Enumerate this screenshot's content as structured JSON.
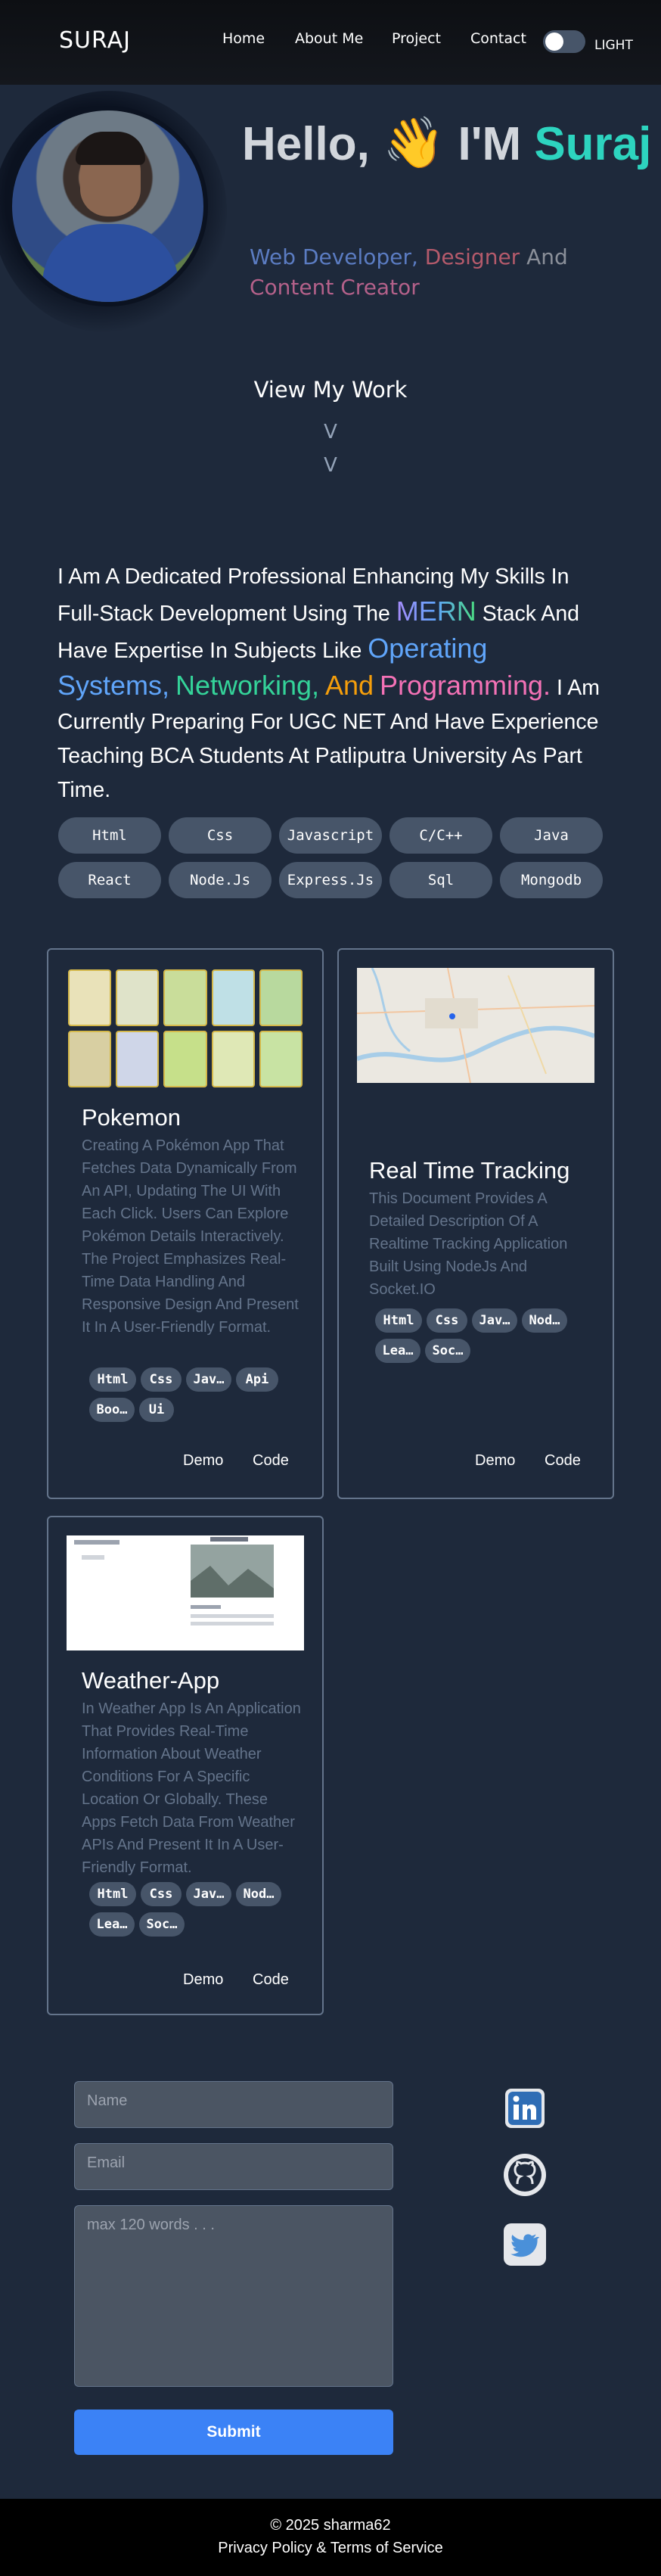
{
  "nav": {
    "brand": "SURAJ",
    "links": [
      "Home",
      "About Me",
      "Project",
      "Contact"
    ],
    "theme_label": "LIGHT",
    "theme_toggle_on": false
  },
  "hero": {
    "greeting": "Hello,",
    "wave": "👋",
    "im": "I'M",
    "name": "Suraj",
    "roles": {
      "role1": "Web Developer,",
      "role2": "Designer",
      "role3": "And",
      "role4": "Content Creator"
    },
    "view_work": "View My Work",
    "chevron": "V"
  },
  "about": {
    "p1": "I Am A Dedicated Professional Enhancing My Skills In Full-Stack Development Using The",
    "mern": "MERN",
    "p2": "Stack And Have Expertise In Subjects Like",
    "subjects": {
      "s1": "Operating Systems,",
      "s2": "Networking,",
      "s3": "And",
      "s4": "Programming."
    },
    "p3": "I Am Currently Preparing For UGC NET And Have Experience Teaching BCA Students At Patliputra University As Part Time."
  },
  "skills": [
    "Html",
    "Css",
    "Javascript",
    "C/C++",
    "Java",
    "React",
    "Node.Js",
    "Express.Js",
    "Sql",
    "Mongodb"
  ],
  "projects": [
    {
      "title": "Pokemon",
      "description": "Creating A Pokémon App That Fetches Data Dynamically From An API, Updating The UI With Each Click. Users Can Explore Pokémon Details Interactively. The Project Emphasizes Real-Time Data Handling And Responsive Design And Present It In A User-Friendly Format.",
      "tags": [
        "Html",
        "Css",
        "Jav…",
        "Api",
        "Boo…",
        "Ui"
      ],
      "demo": "Demo",
      "code": "Code"
    },
    {
      "title": "Real Time Tracking",
      "description": "This Document Provides A Detailed Description Of A Realtime Tracking Application Built Using NodeJs And Socket.IO",
      "tags": [
        "Html",
        "Css",
        "Jav…",
        "Nod…",
        "Lea…",
        "Soc…"
      ],
      "demo": "Demo",
      "code": "Code"
    },
    {
      "title": "Weather-App",
      "description": "In Weather App Is An Application That Provides Real-Time Information About Weather Conditions For A Specific Location Or Globally. These Apps Fetch Data From Weather APIs And Present It In A User-Friendly Format.",
      "tags": [
        "Html",
        "Css",
        "Jav…",
        "Nod…",
        "Lea…",
        "Soc…"
      ],
      "demo": "Demo",
      "code": "Code"
    }
  ],
  "contact": {
    "name_placeholder": "Name",
    "email_placeholder": "Email",
    "message_placeholder": "max 120 words . . .",
    "submit": "Submit",
    "socials": [
      "linkedin-icon",
      "github-icon",
      "twitter-icon"
    ]
  },
  "footer": {
    "copyright": "© 2025 sharma62",
    "links": "Privacy Policy & Terms of Service"
  },
  "colors": {
    "background": "#1e293b",
    "accent_teal": "#2dd4bf",
    "button_blue": "#3b82f6",
    "chip": "#475569"
  }
}
